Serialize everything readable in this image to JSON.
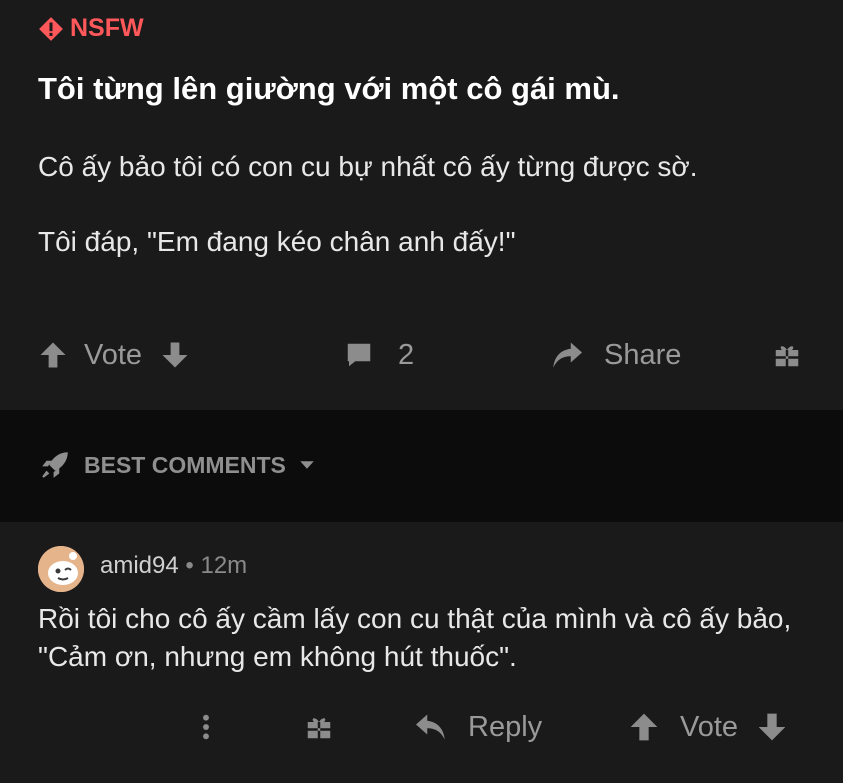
{
  "post": {
    "badge": "NSFW",
    "title": "Tôi từng lên giường với một cô gái mù.",
    "paragraphs": [
      "Cô ấy bảo tôi có con cu bự nhất cô ấy từng được sờ.",
      "Tôi đáp, \"Em đang kéo chân anh đấy!\""
    ],
    "actions": {
      "vote_label": "Vote",
      "comment_count": "2",
      "share_label": "Share"
    }
  },
  "comments_header": {
    "label": "BEST COMMENTS"
  },
  "comment": {
    "username": "amid94",
    "separator": "•",
    "time": "12m",
    "text": "Rồi tôi cho cô ấy cầm lấy con cu thật của mình và cô ấy bảo, \"Cảm ơn, nhưng em không hút thuốc\".",
    "actions": {
      "reply_label": "Reply",
      "vote_label": "Vote"
    }
  },
  "colors": {
    "nsfw": "#ff585b",
    "background": "#1a1a1b",
    "band": "#0c0c0c",
    "muted": "#8c8c8c"
  },
  "icons": [
    "warning-diamond-icon",
    "upvote-arrow-icon",
    "downvote-arrow-icon",
    "comment-bubble-icon",
    "share-arrow-icon",
    "gift-icon",
    "rocket-icon",
    "chevron-down-icon",
    "more-vertical-icon",
    "reply-arrow-icon"
  ]
}
